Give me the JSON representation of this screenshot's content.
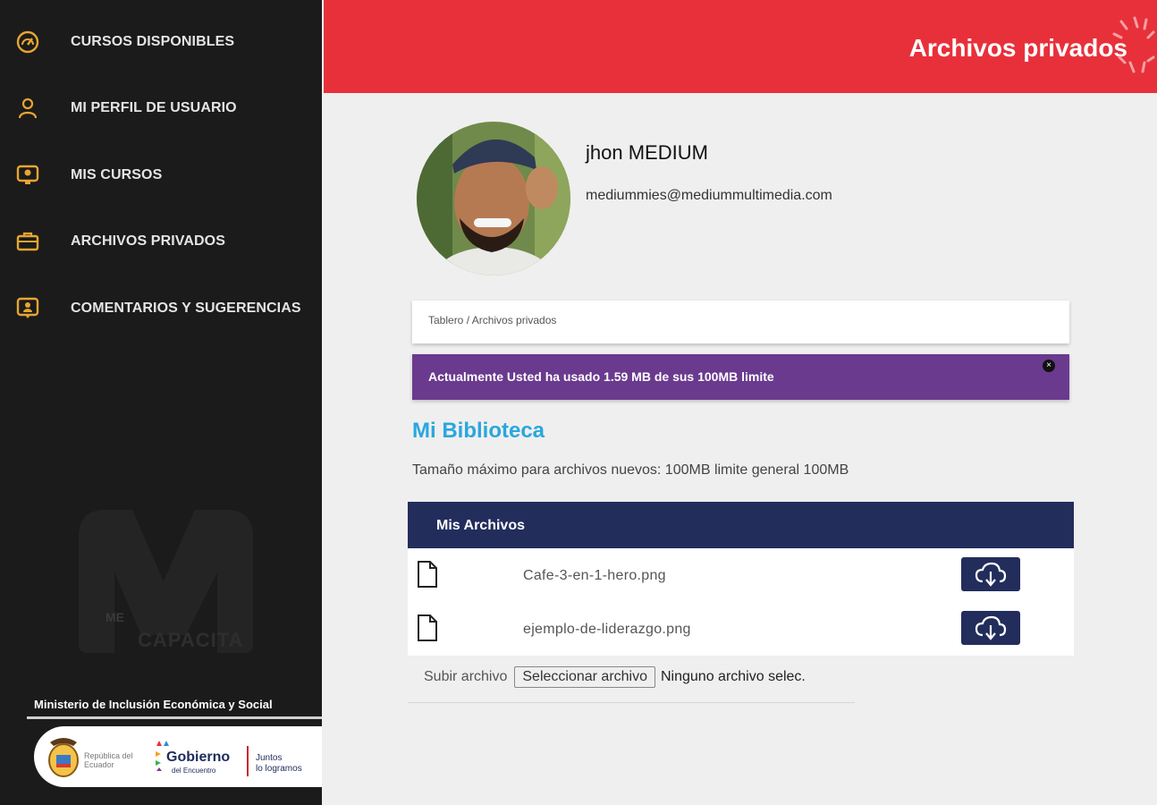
{
  "sidebar": {
    "items": [
      {
        "label": "CURSOS DISPONIBLES",
        "icon": "speedometer-icon"
      },
      {
        "label": "MI PERFIL DE USUARIO",
        "icon": "user-icon"
      },
      {
        "label": "MIS CURSOS",
        "icon": "course-monitor-icon"
      },
      {
        "label": "ARCHIVOS PRIVADOS",
        "icon": "briefcase-icon"
      },
      {
        "label": "COMENTARIOS Y SUGERENCIAS",
        "icon": "feedback-icon"
      }
    ],
    "watermark_line1": "ME",
    "watermark_line2": "CAPACITA",
    "ministry": "Ministerio de Inclusión Económica y Social",
    "gov": {
      "republica": "República del Ecuador",
      "word": "Gobierno",
      "sub": "del Encuentro",
      "slogan_1": "Juntos",
      "slogan_2": "lo logramos"
    }
  },
  "header": {
    "title": "Archivos privados"
  },
  "profile": {
    "name": "jhon MEDIUM",
    "email": "mediummies@mediummultimedia.com"
  },
  "breadcrumb": "Tablero / Archivos privados",
  "alert": {
    "text": "Actualmente Usted ha usado 1.59 MB de sus 100MB limite",
    "close": "×"
  },
  "library": {
    "title": "Mi Biblioteca",
    "max_size": "Tamaño máximo para archivos nuevos: 100MB limite general 100MB"
  },
  "files": {
    "header": "Mis Archivos",
    "rows": [
      {
        "name": "Cafe-3-en-1-hero.png"
      },
      {
        "name": "ejemplo-de-liderazgo.png"
      }
    ]
  },
  "upload": {
    "label": "Subir archivo",
    "button": "Seleccionar archivo",
    "status": "Ninguno archivo selec."
  },
  "colors": {
    "header_red": "#e8303b",
    "sidebar_bg": "#1b1b1b",
    "icon_gold": "#e6a531",
    "alert_purple": "#6a3a8e",
    "table_navy": "#222d5c",
    "title_blue": "#29a7de"
  }
}
